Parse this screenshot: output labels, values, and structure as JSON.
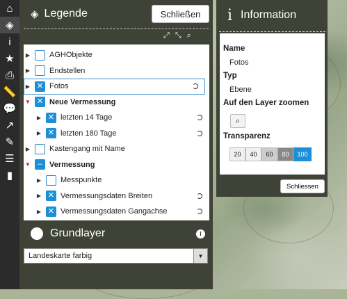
{
  "toolbar": {
    "items": [
      {
        "icon": "home-icon",
        "glyph": "⌂"
      },
      {
        "icon": "layers-icon",
        "glyph": "◈"
      },
      {
        "icon": "info-icon",
        "glyph": "i"
      },
      {
        "icon": "star-icon",
        "glyph": "★"
      },
      {
        "icon": "print-icon",
        "glyph": "⎙"
      },
      {
        "icon": "measure-icon",
        "glyph": "📏"
      },
      {
        "icon": "comment-icon",
        "glyph": "💬"
      },
      {
        "icon": "share-icon",
        "glyph": "↗"
      },
      {
        "icon": "edit-icon",
        "glyph": "✎"
      },
      {
        "icon": "list-icon",
        "glyph": "☰"
      },
      {
        "icon": "chart-icon",
        "glyph": "▮"
      }
    ]
  },
  "legend": {
    "title": "Legende",
    "close_label": "Schließen",
    "layers": [
      {
        "label": "AGHObjekte",
        "checked": false,
        "expanded": false,
        "bold": false,
        "indent": 0,
        "loading": false
      },
      {
        "label": "Endstellen",
        "checked": false,
        "expanded": false,
        "bold": false,
        "indent": 0,
        "loading": false
      },
      {
        "label": "Fotos",
        "checked": true,
        "expanded": false,
        "bold": false,
        "indent": 0,
        "loading": true,
        "selected": true
      },
      {
        "label": "Neue Vermessung",
        "checked": true,
        "expanded": true,
        "bold": true,
        "indent": 0,
        "loading": false
      },
      {
        "label": "letzten 14 Tage",
        "checked": true,
        "expanded": false,
        "bold": false,
        "indent": 1,
        "loading": true
      },
      {
        "label": "letzten 180 Tage",
        "checked": true,
        "expanded": false,
        "bold": false,
        "indent": 1,
        "loading": true
      },
      {
        "label": "Kastengang mit Name",
        "checked": false,
        "expanded": false,
        "bold": false,
        "indent": 0,
        "loading": false
      },
      {
        "label": "Vermessung",
        "checked": "partial",
        "expanded": true,
        "bold": true,
        "indent": 0,
        "loading": false
      },
      {
        "label": "Messpunkte",
        "checked": false,
        "expanded": false,
        "bold": false,
        "indent": 1,
        "loading": false
      },
      {
        "label": "Vermessungsdaten Breiten",
        "checked": true,
        "expanded": false,
        "bold": false,
        "indent": 1,
        "loading": true
      },
      {
        "label": "Vermessungsdaten Gangachse",
        "checked": true,
        "expanded": false,
        "bold": false,
        "indent": 1,
        "loading": true
      }
    ]
  },
  "grundlayer": {
    "title": "Grundlayer",
    "selected": "Landeskarte farbig"
  },
  "info": {
    "title": "Information",
    "name_key": "Name",
    "name_value": "Fotos",
    "type_key": "Typ",
    "type_value": "Ebene",
    "zoom_key": "Auf den Layer zoomen",
    "transparency_key": "Transparenz",
    "transparency_options": [
      "20",
      "40",
      "60",
      "80",
      "100"
    ],
    "transparency_selected": "100",
    "close_label": "Schliessen"
  },
  "colors": {
    "panel_bg": "#3f4236",
    "accent": "#1d8fd8",
    "expanded_arrow": "#c62828"
  }
}
